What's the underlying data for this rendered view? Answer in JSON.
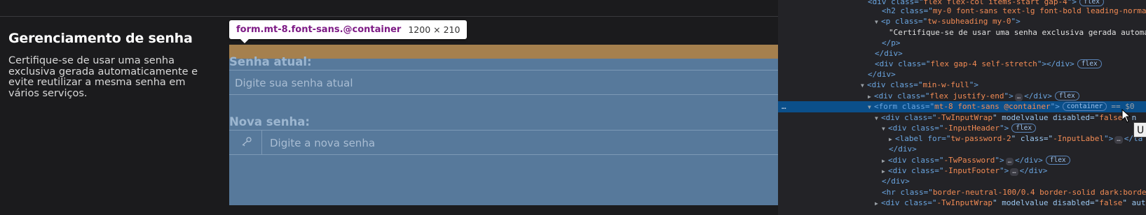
{
  "section": {
    "title": "Gerenciamento de senha",
    "description": "Certifique-se de usar uma senha exclusiva gerada automaticamente e evite reutilizar a mesma senha em vários serviços."
  },
  "form": {
    "current_label": "Senha atual:",
    "current_placeholder": "Digite sua senha atual",
    "new_label": "Nova senha:",
    "new_placeholder": "Digite a nova senha",
    "icon": "key-icon"
  },
  "tooltip": {
    "selector": "form.mt-8.font-sans.@container",
    "dimensions": "1200 × 210"
  },
  "devtools": {
    "row0": {
      "pre": "<div class=\"",
      "val": "flex flex-col items-start gap-4",
      "post": "\">",
      "badge": "flex"
    },
    "row1": {
      "tag": "<h2 class=\"",
      "val": "my-0 font-sans text-lg font-bold leading-norma",
      "post": ""
    },
    "row2": {
      "tag": "<p class=\"",
      "val": "tw-subheading my-0",
      "post": "\">"
    },
    "row3": {
      "text": "\"Certifique-se de usar uma senha exclusiva gerada automa"
    },
    "row4": {
      "tag": "</p>"
    },
    "row5": {
      "tag": "</div>"
    },
    "row6": {
      "tag": "<div class=\"",
      "val": "flex gap-4 self-stretch",
      "post": "\"></div>",
      "badge": "flex"
    },
    "row7": {
      "tag": "</div>"
    },
    "row8": {
      "tag": "<div class=\"",
      "val": "min-w-full",
      "post": "\">"
    },
    "row9": {
      "tag": "<div class=\"",
      "val": "flex justify-end",
      "post": "\">",
      "dots": "…",
      "close": "</div>",
      "badge": "flex"
    },
    "row10": {
      "tag": "<form class=\"",
      "val": "mt-8 font-sans @container",
      "post": "\">",
      "badge": "container",
      "eq": "== $0",
      "gutter": "…"
    },
    "row11": {
      "tag": "<div class=\"",
      "val": "-TwInputWrap",
      "post": "\" modelvalue disabled=\"",
      "val2": "false",
      "post2": "\" n"
    },
    "row12": {
      "tag": "<div class=\"",
      "val": "-InputHeader",
      "post": "\">",
      "badge": "flex"
    },
    "row13": {
      "tag": "<label for=\"",
      "val": "tw-password-2",
      "post": "\" class=\"",
      "val2": "-InputLabel",
      "post2": "\">",
      "dots": "…",
      "close": "</la"
    },
    "row14": {
      "tag": "</div>"
    },
    "row15": {
      "tag": "<div class=\"",
      "val": "-TwPassword",
      "post": "\">",
      "dots": "…",
      "close": "</div>",
      "badge": "flex"
    },
    "row16": {
      "tag": "<div class=\"",
      "val": "-InputFooter",
      "post": "\">",
      "dots": "…",
      "close": "</div>"
    },
    "row17": {
      "tag": "</div>"
    },
    "row18": {
      "tag": "<hr class=\"",
      "val": "border-neutral-100/0.4 border-solid dark:borde"
    },
    "row19": {
      "tag": "<div class=\"",
      "val": "-TwInputWrap",
      "post": "\" modelvalue disabled=\"",
      "val2": "false",
      "post2": "\" aut"
    }
  },
  "hover_tooltip": "U"
}
